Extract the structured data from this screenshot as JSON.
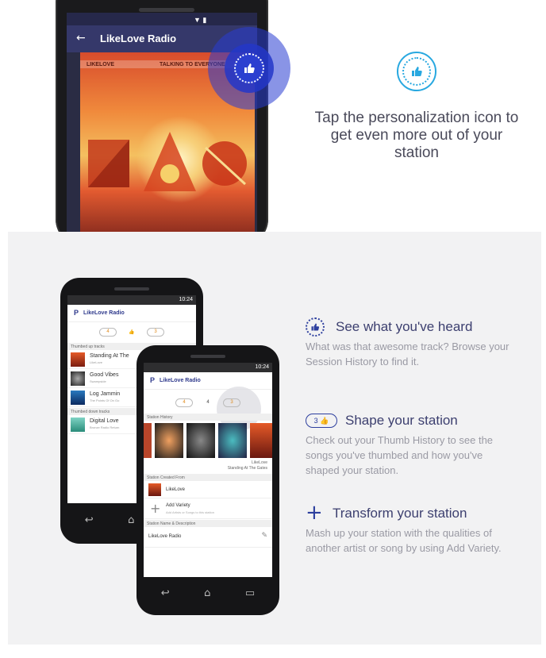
{
  "colors": {
    "accent": "#2b3fd0",
    "heading": "#3c3f6f",
    "body_text": "#9a9aa4",
    "badge_ring": "#28a8e0"
  },
  "hero": {
    "app_title": "LikeLove Radio",
    "back_icon": "arrow-left-icon",
    "album_labels": [
      "LIKELOVE",
      "TALKING TO EVERYONE"
    ],
    "personalization_icon": "thumbs-up-icon",
    "headline": "Tap the personalization icon to get even more out of your station"
  },
  "phone_back": {
    "time": "10:24",
    "title": "LikeLove Radio",
    "pills": [
      "4",
      "3"
    ],
    "thumbed_up_header": "Thumbed up tracks",
    "thumbed_up": [
      {
        "title": "Standing At The",
        "artist": "LikeLove"
      },
      {
        "title": "Good Vibes",
        "artist": "Swampside"
      },
      {
        "title": "Log Jammin",
        "artist": "The Points Of On Go"
      }
    ],
    "thumbed_down_header": "Thumbed down tracks",
    "thumbed_down": [
      {
        "title": "Digital Love",
        "artist": "Bronze Radio Return"
      }
    ]
  },
  "phone_front": {
    "time": "10:24",
    "title": "LikeLove Radio",
    "pills": [
      "4",
      "4",
      "3"
    ],
    "history_header": "Station History",
    "history_caption": [
      "LikeLove",
      "Standing At The Gates"
    ],
    "created_header": "Station Created From",
    "created_from": "LikeLove",
    "add_variety": "Add Variety",
    "add_variety_sub": "Add Artists or Songs to this station",
    "name_header": "Station Name & Description",
    "station_name": "LikeLove Radio"
  },
  "features": [
    {
      "icon": "dotted-thumbs-up-icon",
      "title": "See what you've heard",
      "body": "What was that awesome track? Browse your Session History to find it."
    },
    {
      "icon": "thumb-count-pill-icon",
      "pill": "3",
      "title": "Shape your station",
      "body": "Check out your Thumb History to see the songs you've thumbed and how you've shaped your station."
    },
    {
      "icon": "plus-icon",
      "title": "Transform your station",
      "body": "Mash up your station with the qualities of another artist or song by using Add Variety."
    }
  ]
}
